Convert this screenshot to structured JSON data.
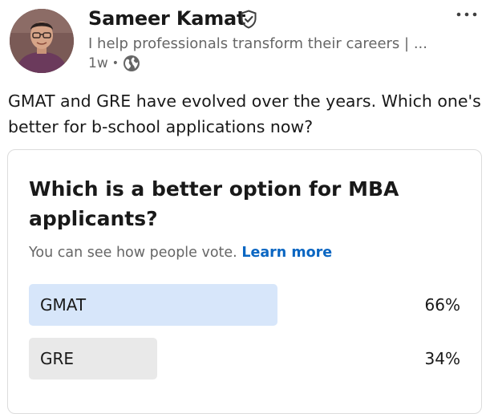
{
  "post": {
    "author": {
      "name": "Sameer Kamat",
      "headline": "I help professionals transform their careers | ...",
      "time": "1w",
      "separator": "•",
      "visibility_icon": "globe-icon",
      "verified_icon": "shield-check-icon"
    },
    "more_icon": "more-horizontal-icon",
    "text": "GMAT and GRE have evolved over the years. Which one's better for b-school applications now?"
  },
  "poll": {
    "question": "Which is a better option for MBA applicants?",
    "note": "You can see how people vote.",
    "learn_more": "Learn more",
    "options": [
      {
        "label": "GMAT",
        "percent_text": "66%",
        "percent": 66,
        "leading": true
      },
      {
        "label": "GRE",
        "percent_text": "34%",
        "percent": 34,
        "leading": false
      }
    ]
  },
  "colors": {
    "accent": "#0a66c2",
    "leading_bar": "#d7e6fa",
    "other_bar": "#e9e9e9",
    "secondary_text": "#666666"
  }
}
